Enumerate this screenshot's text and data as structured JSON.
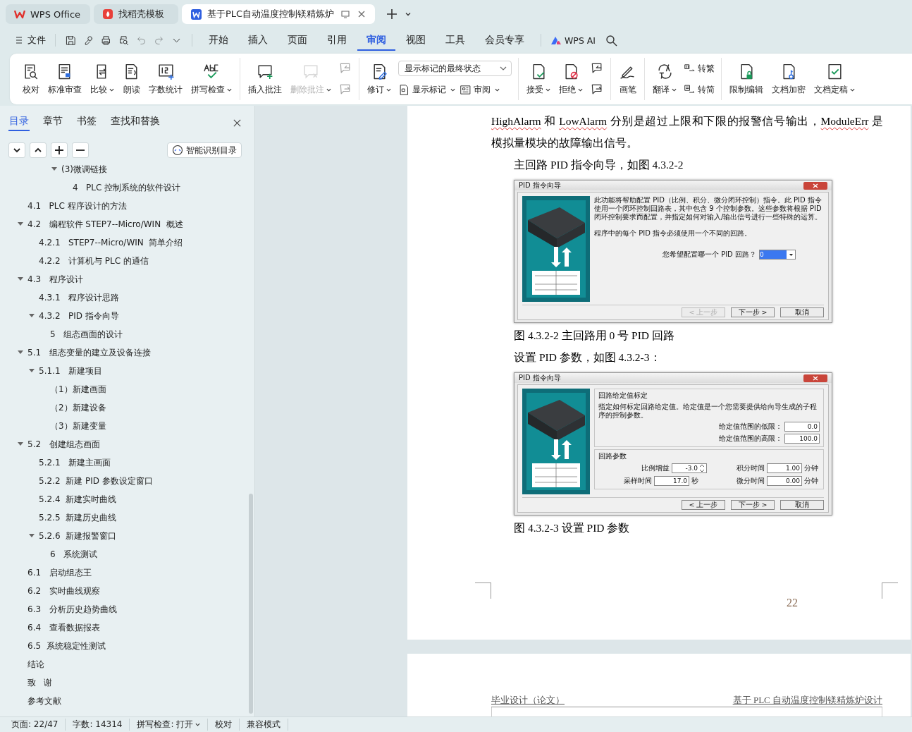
{
  "window_tabs": [
    {
      "kind": "home",
      "label": "WPS Office",
      "selected": false
    },
    {
      "kind": "template",
      "label": "找稻壳模板",
      "selected": false
    },
    {
      "kind": "document",
      "label": "基于PLC自动温度控制镁精炼炉",
      "selected": true
    }
  ],
  "menu": {
    "file_label": "文件",
    "quick_access": [
      {
        "kind": "save",
        "disabled": false
      },
      {
        "kind": "brush",
        "disabled": false
      },
      {
        "kind": "print",
        "disabled": false
      },
      {
        "kind": "preview",
        "disabled": false
      },
      {
        "kind": "undo",
        "disabled": true
      },
      {
        "kind": "redo",
        "disabled": true
      },
      {
        "kind": "more",
        "disabled": false
      }
    ],
    "tabs": [
      {
        "label": "开始",
        "selected": false
      },
      {
        "label": "插入",
        "selected": false
      },
      {
        "label": "页面",
        "selected": false
      },
      {
        "label": "引用",
        "selected": false
      },
      {
        "label": "审阅",
        "selected": true
      },
      {
        "label": "视图",
        "selected": false
      },
      {
        "label": "工具",
        "selected": false
      },
      {
        "label": "会员专享",
        "selected": false
      }
    ],
    "ai_label": "WPS AI"
  },
  "ribbon": [
    {
      "buttons": [
        {
          "kind": "proof",
          "label": "校对",
          "dropdown": false,
          "disabled": false
        },
        {
          "kind": "stamp",
          "label": "标准审查",
          "dropdown": false,
          "disabled": false
        },
        {
          "kind": "compare",
          "label": "比较",
          "dropdown": true,
          "disabled": false
        },
        {
          "kind": "read",
          "label": "朗读",
          "dropdown": false,
          "disabled": false
        },
        {
          "kind": "count",
          "label": "字数统计",
          "dropdown": false,
          "disabled": false
        },
        {
          "kind": "spell",
          "label": "拼写检查",
          "dropdown": true,
          "disabled": false
        }
      ]
    },
    {
      "buttons": [
        {
          "kind": "comment-add",
          "label": "插入批注",
          "dropdown": false,
          "disabled": false
        },
        {
          "kind": "comment-del",
          "label": "删除批注",
          "dropdown": true,
          "disabled": true
        }
      ],
      "stack": [
        [
          {
            "kind": "comment-prev",
            "disabled": true
          }
        ],
        [
          {
            "kind": "comment-next",
            "disabled": true
          }
        ]
      ]
    },
    {
      "buttons": [
        {
          "kind": "track",
          "label": "修订",
          "dropdown": true,
          "disabled": false
        }
      ],
      "stack": [
        [
          {
            "kind": "select",
            "value": "显示标记的最终状态"
          }
        ],
        [
          {
            "kind": "markup",
            "label": "显示标记",
            "dropdown": true
          },
          {
            "kind": "pane",
            "label": "审阅",
            "dropdown": true
          }
        ]
      ]
    },
    {
      "buttons": [
        {
          "kind": "accept",
          "label": "接受",
          "dropdown": true,
          "disabled": false
        },
        {
          "kind": "reject",
          "label": "拒绝",
          "dropdown": true,
          "disabled": false
        }
      ],
      "stack": [
        [
          {
            "kind": "change-prev",
            "disabled": false
          }
        ],
        [
          {
            "kind": "change-next",
            "disabled": false
          }
        ]
      ]
    },
    {
      "buttons": [
        {
          "kind": "pen",
          "label": "画笔",
          "dropdown": false,
          "disabled": false
        }
      ]
    },
    {
      "buttons": [
        {
          "kind": "translate",
          "label": "翻译",
          "dropdown": true,
          "disabled": false
        }
      ],
      "stack": [
        [
          {
            "kind": "to-trad",
            "label": "转繁",
            "dropdown": false
          }
        ],
        [
          {
            "kind": "to-simp",
            "label": "转简",
            "dropdown": false
          }
        ]
      ]
    },
    {
      "buttons": [
        {
          "kind": "lock",
          "label": "限制编辑",
          "dropdown": false,
          "disabled": false
        },
        {
          "kind": "key",
          "label": "文档加密",
          "dropdown": false,
          "disabled": false
        },
        {
          "kind": "final",
          "label": "文档定稿",
          "dropdown": true,
          "disabled": false
        }
      ]
    }
  ],
  "sidebar": {
    "tabs": [
      {
        "label": "目录",
        "selected": true
      },
      {
        "label": "章节",
        "selected": false
      },
      {
        "label": "书签",
        "selected": false
      },
      {
        "label": "查找和替换",
        "selected": false
      }
    ],
    "tools": [
      {
        "kind": "expand"
      },
      {
        "kind": "collapse"
      },
      {
        "kind": "add"
      },
      {
        "kind": "remove"
      }
    ],
    "smart_button": "智能识别目录",
    "toc_continued": [
      {
        "title": "(3)微调链接",
        "expanded": true,
        "children": [
          {
            "title": "4   PLC 控制系统的软件设计"
          }
        ]
      }
    ],
    "toc": [
      {
        "title": "4.1   PLC 程序设计的方法"
      },
      {
        "title": "4.2   编程软件 STEP7--Micro/WIN  概述",
        "expanded": true,
        "children": [
          {
            "title": "4.2.1   STEP7--Micro/WIN  简单介绍"
          },
          {
            "title": "4.2.2   计算机与 PLC 的通信"
          }
        ]
      },
      {
        "title": "4.3   程序设计",
        "expanded": true,
        "children": [
          {
            "title": "4.3.1   程序设计思路"
          },
          {
            "title": "4.3.2   PID 指令向导",
            "expanded": true,
            "children": [
              {
                "title": "5   组态画面的设计"
              }
            ]
          }
        ]
      },
      {
        "title": "5.1   组态变量的建立及设备连接",
        "expanded": true,
        "children": [
          {
            "title": "5.1.1   新建项目",
            "expanded": true,
            "children": [
              {
                "title": "（1）新建画面"
              },
              {
                "title": "（2）新建设备"
              },
              {
                "title": "（3）新建变量"
              }
            ]
          }
        ]
      },
      {
        "title": "5.2   创建组态画面",
        "expanded": true,
        "children": [
          {
            "title": "5.2.1   新建主画面"
          },
          {
            "title": "5.2.2  新建 PID 参数设定窗口"
          },
          {
            "title": "5.2.4  新建实时曲线"
          },
          {
            "title": "5.2.5  新建历史曲线"
          },
          {
            "title": "5.2.6  新建报警窗口",
            "expanded": true,
            "children": [
              {
                "title": "6   系统测试"
              }
            ]
          }
        ]
      },
      {
        "title": "6.1   启动组态王"
      },
      {
        "title": "6.2   实时曲线观察"
      },
      {
        "title": "6.3   分析历史趋势曲线"
      },
      {
        "title": "6.4   查看数据报表"
      },
      {
        "title": "6.5  系统稳定性测试"
      },
      {
        "title": "结论"
      },
      {
        "title": "致   谢"
      },
      {
        "title": "参考文献"
      }
    ]
  },
  "page": {
    "blocks": [
      {
        "kind": "paragraph",
        "indent": false,
        "segments": [
          {
            "text": "HighAlarm",
            "misspelled": true
          },
          {
            "text": " 和 ",
            "misspelled": false
          },
          {
            "text": "LowAlarm",
            "misspelled": true
          },
          {
            "text": " 分别是超过上限和下限的报警信号输出，",
            "misspelled": false
          },
          {
            "text": "ModuleErr",
            "misspelled": true
          },
          {
            "text": " 是模拟量模块的故障输出信号。",
            "misspelled": false
          }
        ]
      },
      {
        "kind": "paragraph",
        "indent": true,
        "segments": [
          {
            "text": "主回路 PID 指令向导，如图 4.3.2-2",
            "misspelled": false
          }
        ]
      },
      {
        "kind": "figure",
        "dialog": {
          "kind": "loop_wizard",
          "title": "PID 指令向导",
          "intro": "此功能将帮助配置 PID（比例、积分、微分闭环控制）指令。此 PID 指令使用一个闭环控制回路表，其中包含 9 个控制参数。这些参数将根据 PID 闭环控制要求而配置，并指定如何对输入/输出信号进行一些特殊的运算。",
          "note": "程序中的每个 PID 指令必须使用一个不同的回路。",
          "question": "您希望配置哪一个 PID 回路？",
          "select_value": "0",
          "buttons": [
            {
              "label": "< 上一步",
              "disabled": true
            },
            {
              "label": "下一步 >",
              "disabled": false
            },
            {
              "label": "取消",
              "disabled": false
            }
          ]
        }
      },
      {
        "kind": "caption",
        "segments": [
          {
            "text": "图  4.3.2-2  主回路用 0 号 PID 回路",
            "misspelled": false
          }
        ]
      },
      {
        "kind": "paragraph",
        "indent": true,
        "segments": [
          {
            "text": "设置 PID 参数，如图 4.3.2-3：",
            "misspelled": false
          }
        ]
      },
      {
        "kind": "figure",
        "dialog": {
          "kind": "parameter_wizard",
          "title": "PID 指令向导",
          "groups": [
            {
              "kind": "stacked",
              "legend": "回路给定值标定",
              "description": "指定如何标定回路给定值。给定值是一个您需要提供给向导生成的子程序的控制参数。",
              "fields": [
                {
                  "label": "给定值范围的低限：",
                  "value": "0.0",
                  "spinner": false
                },
                {
                  "label": "给定值范围的高限：",
                  "value": "100.0",
                  "spinner": false
                }
              ]
            },
            {
              "kind": "grid",
              "legend": "回路参数",
              "fields": [
                {
                  "label": "比例增益",
                  "value": "-3.0",
                  "spinner": true
                },
                {
                  "label": "积分时间",
                  "value": "1.00",
                  "unit": "分钟",
                  "spinner": false
                },
                {
                  "label": "采样时间",
                  "value": "17.0",
                  "unit": "秒",
                  "spinner": false
                },
                {
                  "label": "微分时间",
                  "value": "0.00",
                  "unit": "分钟",
                  "spinner": false
                }
              ]
            }
          ],
          "buttons": [
            {
              "label": "< 上一步",
              "disabled": false
            },
            {
              "label": "下一步 >",
              "disabled": false
            },
            {
              "label": "取消",
              "disabled": false
            }
          ]
        }
      },
      {
        "kind": "caption",
        "segments": [
          {
            "text": "图 4.3.2-3  设置 PID 参数",
            "misspelled": false
          }
        ]
      }
    ],
    "page_number": "22"
  },
  "next_page": {
    "header_left": "毕业设计（论文）",
    "header_right": "基于 PLC 自动温度控制镁精炼炉设计"
  },
  "status_bar": [
    {
      "label": "页面: 22/47",
      "dropdown": false
    },
    {
      "label": "字数: 14314",
      "dropdown": false
    },
    {
      "label": "拼写检查: 打开",
      "dropdown": true
    },
    {
      "label": "校对",
      "dropdown": false
    },
    {
      "label": "兼容模式",
      "dropdown": false
    }
  ]
}
